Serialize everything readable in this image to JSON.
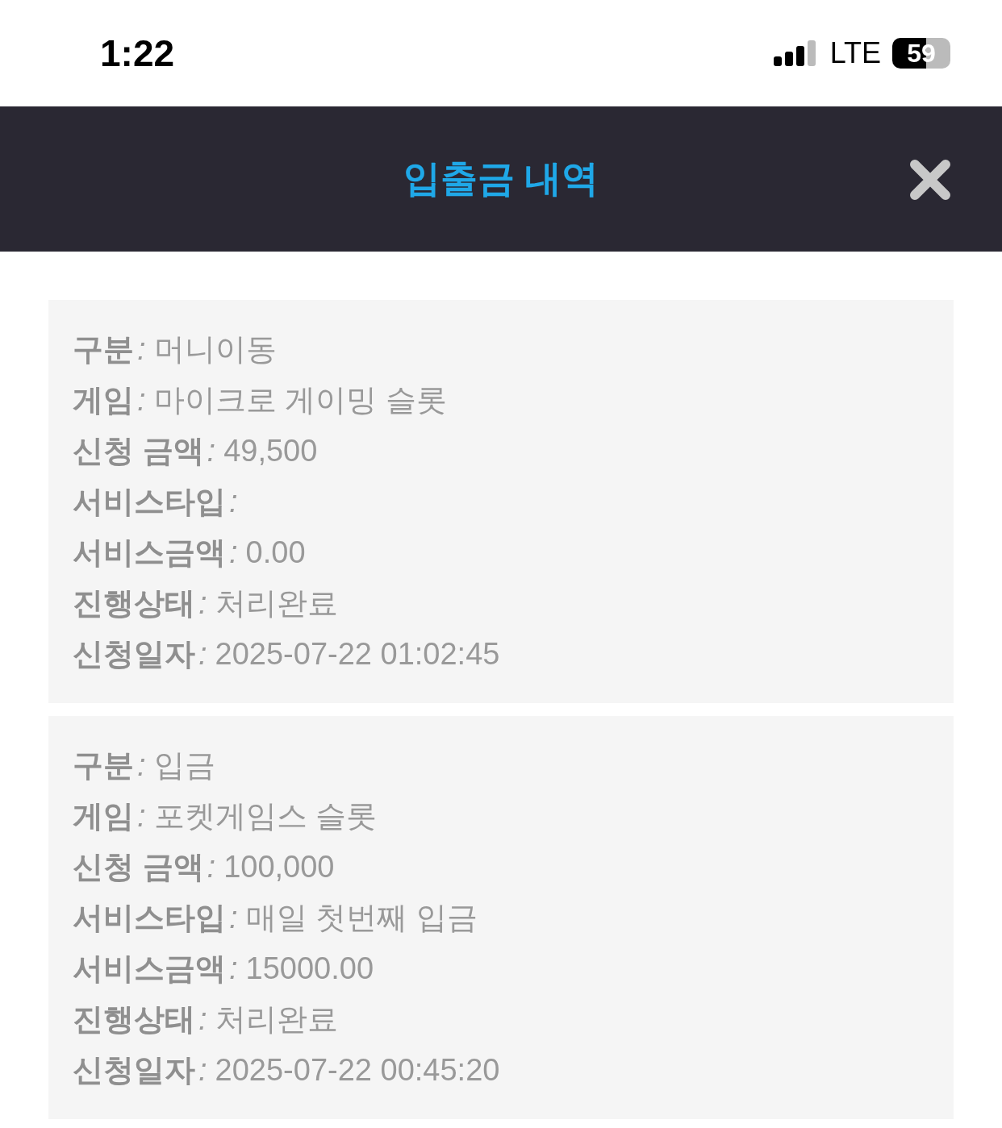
{
  "status_bar": {
    "time": "1:22",
    "network": "LTE",
    "battery": "59"
  },
  "header": {
    "title": "입출금 내역"
  },
  "records": [
    {
      "rows": [
        {
          "label": "구분",
          "sep": ":",
          "value": "머니이동"
        },
        {
          "label": "게임",
          "sep": ":",
          "value": "마이크로 게이밍 슬롯"
        },
        {
          "label": "신청 금액",
          "sep": ":",
          "value": "49,500"
        },
        {
          "label": "서비스타입",
          "sep": ":"
        },
        {
          "label": "서비스금액",
          "sep": ":",
          "value": "0.00"
        },
        {
          "label": "진행상태",
          "sep": ":",
          "value": "처리완료"
        },
        {
          "label": "신청일자",
          "sep": ":",
          "value": "2025-07-22 01:02:45"
        }
      ]
    },
    {
      "rows": [
        {
          "label": "구분",
          "sep": ":",
          "value": "입금"
        },
        {
          "label": "게임",
          "sep": ":",
          "value": "포켓게임스 슬롯"
        },
        {
          "label": "신청 금액",
          "sep": ":",
          "value": "100,000"
        },
        {
          "label": "서비스타입",
          "sep": ":",
          "value": "매일 첫번째 입금"
        },
        {
          "label": "서비스금액",
          "sep": ":",
          "value": "15000.00"
        },
        {
          "label": "진행상태",
          "sep": ":",
          "value": "처리완료"
        },
        {
          "label": "신청일자",
          "sep": ":",
          "value": "2025-07-22 00:45:20"
        }
      ]
    }
  ]
}
